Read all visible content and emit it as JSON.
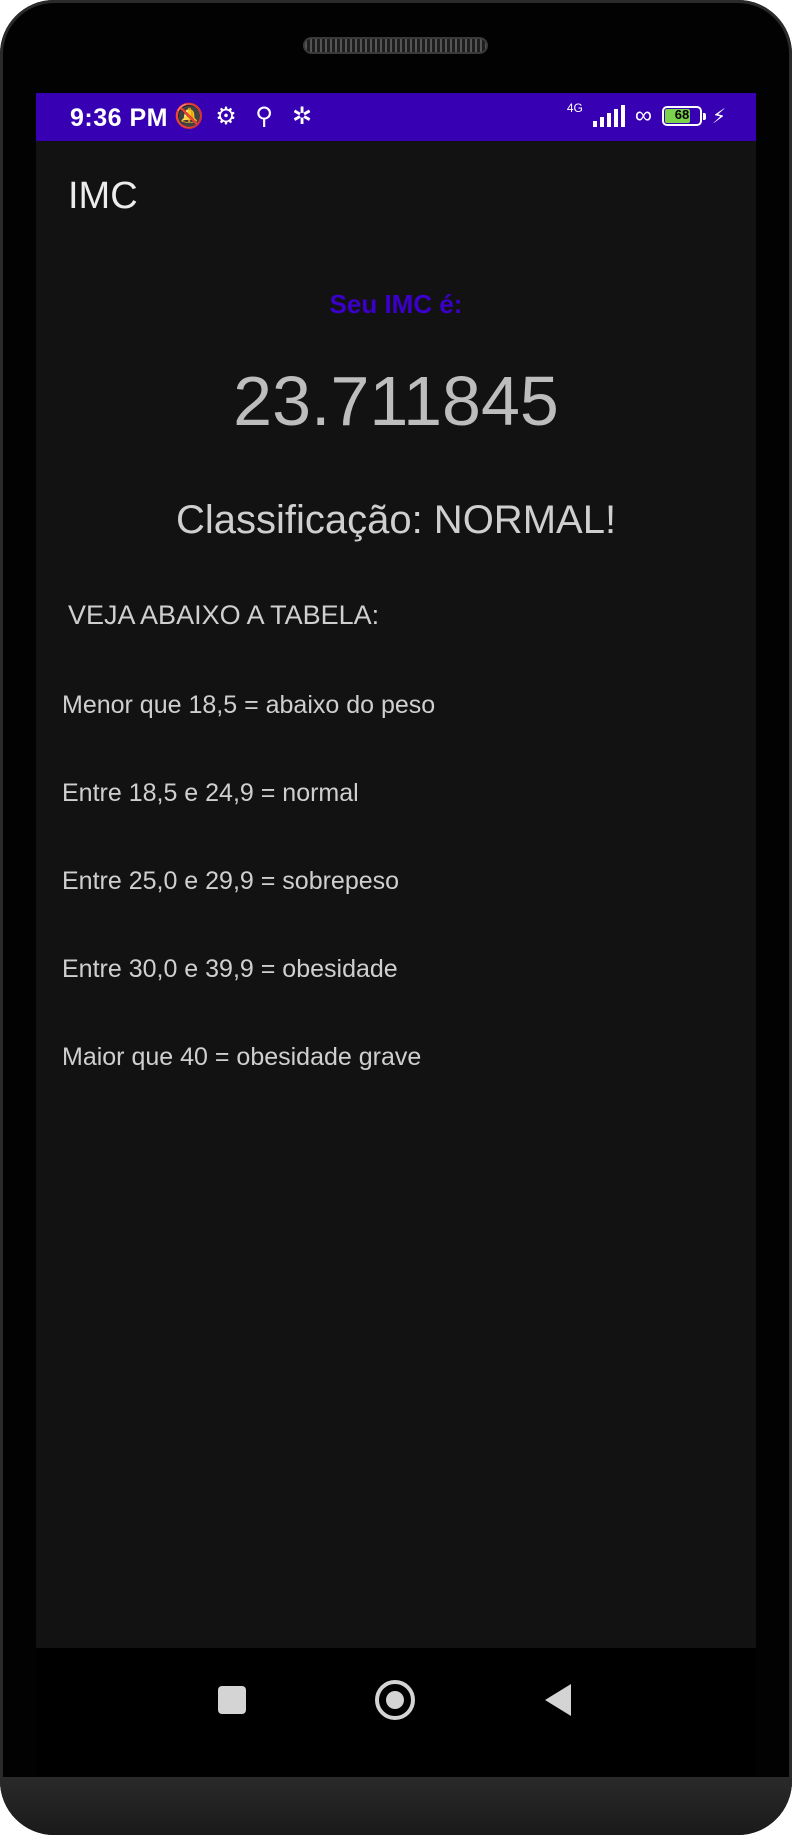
{
  "status_bar": {
    "time": "9:36 PM",
    "icons_left": [
      "bell-off-icon",
      "settings-gear-icon",
      "location-icon",
      "settings-icon"
    ],
    "network_type": "4G",
    "battery_level": "68",
    "color": "#3700b3"
  },
  "app": {
    "title": "IMC"
  },
  "result": {
    "label": "Seu IMC é:",
    "value": "23.711845",
    "classification": "Classificação: NORMAL!"
  },
  "table": {
    "heading": "VEJA ABAIXO A TABELA:",
    "rows": [
      "Menor que 18,5 = abaixo do peso",
      "Entre 18,5 e 24,9 = normal",
      "Entre 25,0 e 29,9 = sobrepeso",
      "Entre 30,0 e 39,9 = obesidade",
      "Maior que 40 = obesidade grave"
    ]
  },
  "colors": {
    "background": "#121212",
    "accent": "#3700b3",
    "label": "#3b00c9",
    "text": "#cfcfcf"
  },
  "navigation": {
    "buttons": [
      "recents-button",
      "home-button",
      "back-button"
    ]
  }
}
